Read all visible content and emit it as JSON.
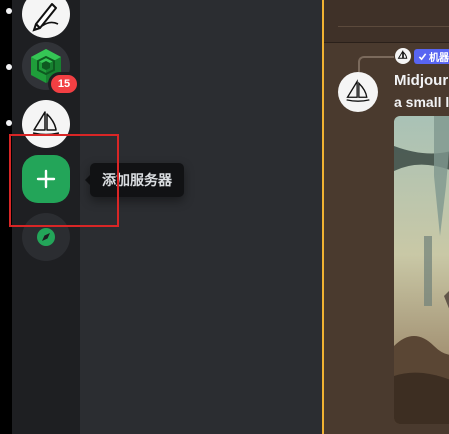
{
  "server_rail": {
    "notification_badge": "15",
    "add_server_tooltip": "添加服务器"
  },
  "chat": {
    "reply_bot_tag": "机器",
    "author_name": "Midjourn",
    "message_text": "a small l"
  },
  "colors": {
    "add_server_green": "#23a559",
    "badge_red": "#f23f43",
    "bot_tag_blurple": "#5865f2",
    "highlight_red": "#d92626",
    "accent_orange": "#f0b232"
  },
  "icons": {
    "server_1": "pencil-drawing-icon",
    "server_2": "green-cube-icon",
    "server_3": "midjourney-sailboat-icon",
    "add": "plus-icon",
    "explore": "compass-icon"
  }
}
